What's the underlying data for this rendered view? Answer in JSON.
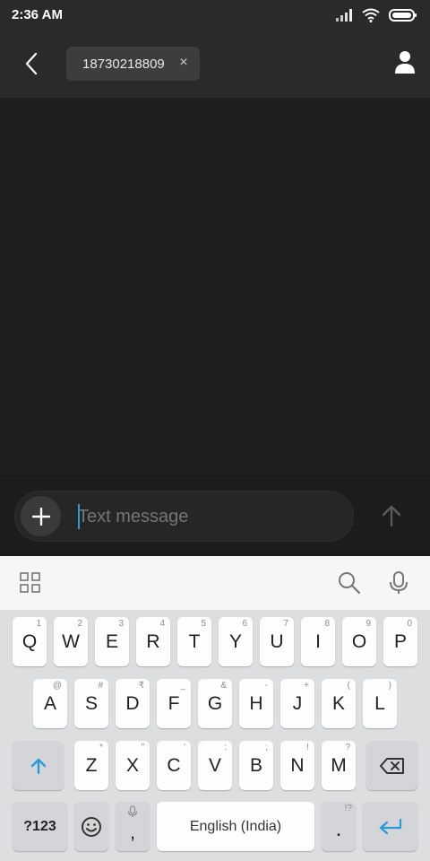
{
  "status_bar": {
    "time": "2:36 AM",
    "icons": [
      "signal-icon",
      "wifi-icon",
      "battery-icon"
    ]
  },
  "header": {
    "back_icon": "back-arrow-icon",
    "recipient": "18730218809",
    "remove_icon": "close-icon",
    "contact_icon": "person-icon"
  },
  "compose": {
    "placeholder": "Text message",
    "attach_icon": "plus-icon",
    "send_icon": "send-arrow-icon"
  },
  "keyboard_toolbar": {
    "icons": [
      "grid-icon",
      "search-icon",
      "mic-icon"
    ]
  },
  "keyboard": {
    "row1": [
      {
        "k": "Q",
        "h": "1"
      },
      {
        "k": "W",
        "h": "2"
      },
      {
        "k": "E",
        "h": "3"
      },
      {
        "k": "R",
        "h": "4"
      },
      {
        "k": "T",
        "h": "5"
      },
      {
        "k": "Y",
        "h": "6"
      },
      {
        "k": "U",
        "h": "7"
      },
      {
        "k": "I",
        "h": "8"
      },
      {
        "k": "O",
        "h": "9"
      },
      {
        "k": "P",
        "h": "0"
      }
    ],
    "row2": [
      {
        "k": "A",
        "h": "@"
      },
      {
        "k": "S",
        "h": "#"
      },
      {
        "k": "D",
        "h": "₹"
      },
      {
        "k": "F",
        "h": "_"
      },
      {
        "k": "G",
        "h": "&"
      },
      {
        "k": "H",
        "h": "-"
      },
      {
        "k": "J",
        "h": "+"
      },
      {
        "k": "K",
        "h": "("
      },
      {
        "k": "L",
        "h": ")"
      }
    ],
    "row3": [
      {
        "k": "Z",
        "h": "*"
      },
      {
        "k": "X",
        "h": "\""
      },
      {
        "k": "C",
        "h": "'"
      },
      {
        "k": "V",
        "h": ":"
      },
      {
        "k": "B",
        "h": ";"
      },
      {
        "k": "N",
        "h": "!"
      },
      {
        "k": "M",
        "h": "?"
      }
    ],
    "symbols_label": "?123",
    "comma": ",",
    "space_label": "English (India)",
    "period": ".",
    "period_hint": "!?"
  },
  "colors": {
    "accent": "#2b9bd8",
    "background": "#1f1f1f",
    "keyboard_bg": "#dcdee0"
  }
}
